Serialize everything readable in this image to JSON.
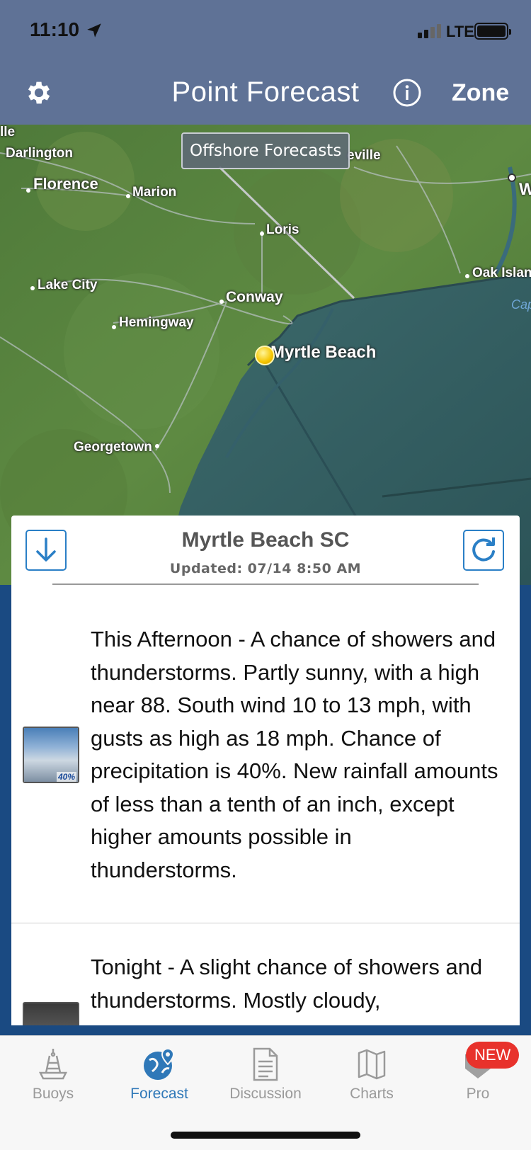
{
  "status_bar": {
    "time": "11:10",
    "network": "LTE"
  },
  "header": {
    "title": "Point Forecast",
    "zone_label": "Zone"
  },
  "map": {
    "offshore_button": "Offshore Forecasts",
    "labels": {
      "ille": "lle",
      "darlington": "Darlington",
      "florence": "Florence",
      "marion": "Marion",
      "eville": "eville",
      "loris": "Loris",
      "lake_city": "Lake City",
      "oak_island": "Oak Islan",
      "conway": "Conway",
      "hemingway": "Hemingway",
      "myrtle_beach": "Myrtle Beach",
      "georgetown": "Georgetown",
      "cap": "Cap",
      "w": "W"
    }
  },
  "location": {
    "name": "Myrtle Beach SC",
    "updated": "Updated: 07/14 8:50 AM"
  },
  "forecasts": [
    {
      "text": "This Afternoon - A chance of showers and thunderstorms.  Partly sunny, with a high near 88. South wind 10 to 13 mph, with gusts as high as 18 mph. Chance of precipitation is 40%. New rainfall amounts of less than a tenth of an inch, except higher amounts possible in thunderstorms.",
      "icon_badge": "40%",
      "icon": "partly-cloudy-tstorm-icon"
    },
    {
      "text": "Tonight - A slight chance of showers and thunderstorms.  Mostly cloudy,",
      "icon": "night-cloudy-icon"
    }
  ],
  "tabs": [
    {
      "label": "Buoys",
      "icon": "buoy-icon"
    },
    {
      "label": "Forecast",
      "icon": "globe-pin-icon",
      "active": true
    },
    {
      "label": "Discussion",
      "icon": "document-icon"
    },
    {
      "label": "Charts",
      "icon": "map-icon"
    },
    {
      "label": "Pro",
      "icon": "pro-icon",
      "badge": "NEW"
    }
  ],
  "colors": {
    "header_bg": "#5f7296",
    "accent": "#2f78b8",
    "badge": "#e8322c",
    "page_bg": "#1a4a82"
  }
}
